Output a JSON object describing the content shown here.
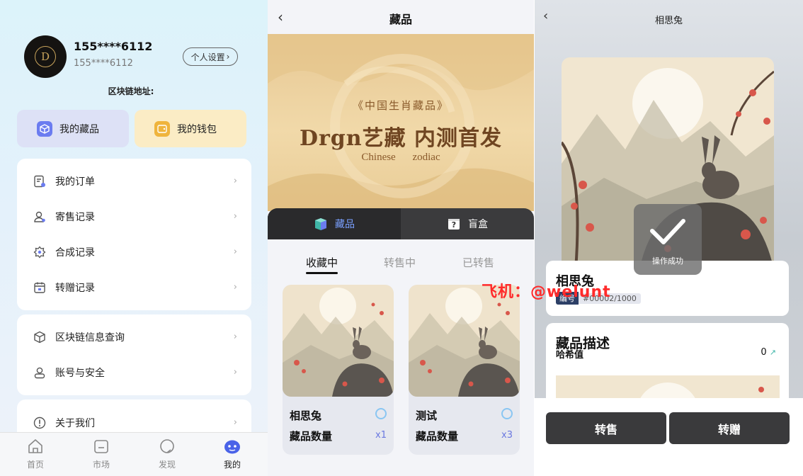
{
  "profile": {
    "name": "155****6112",
    "sub": "155****6112",
    "settings_label": "个人设置",
    "chain_label": "区块链地址:",
    "quick": [
      {
        "label": "我的藏品",
        "icon": "cube-icon"
      },
      {
        "label": "我的钱包",
        "icon": "wallet-icon"
      }
    ],
    "menu_group1": [
      {
        "label": "我的订单",
        "icon": "order-icon"
      },
      {
        "label": "寄售记录",
        "icon": "user-sale-icon"
      },
      {
        "label": "合成记录",
        "icon": "gear-star-icon"
      },
      {
        "label": "转赠记录",
        "icon": "calendar-icon"
      }
    ],
    "menu_group2": [
      {
        "label": "区块链信息查询",
        "icon": "cube-outline-icon"
      },
      {
        "label": "账号与安全",
        "icon": "account-icon"
      }
    ],
    "menu_group3": [
      {
        "label": "关于我们",
        "icon": "info-icon"
      }
    ],
    "tabs": [
      {
        "label": "首页",
        "icon": "home-icon"
      },
      {
        "label": "市场",
        "icon": "market-icon"
      },
      {
        "label": "发现",
        "icon": "discover-icon"
      },
      {
        "label": "我的",
        "icon": "mine-icon"
      }
    ],
    "accent": "#6b7cf0"
  },
  "collection": {
    "title": "藏品",
    "banner": {
      "sub": "《中国生肖藏品》",
      "title": "Drgn艺藏 内测首发",
      "en": "Chinese zodiac"
    },
    "segments": [
      "藏品",
      "盲盒"
    ],
    "subtabs": [
      "收藏中",
      "转售中",
      "已转售"
    ],
    "items": [
      {
        "name": "相思兔",
        "qty_label": "藏品数量",
        "qty": "x1"
      },
      {
        "name": "测试",
        "qty_label": "藏品数量",
        "qty": "x3"
      }
    ],
    "watermark": "飞机：@welunt"
  },
  "detail": {
    "title": "相思兔",
    "toast": "操作成功",
    "name": "相思兔",
    "code_key": "编号",
    "code_value": "#00002/1000",
    "desc_title": "藏品描述",
    "hash_label": "哈希值",
    "hash_value": "0",
    "actions": [
      "转售",
      "转赠"
    ]
  }
}
